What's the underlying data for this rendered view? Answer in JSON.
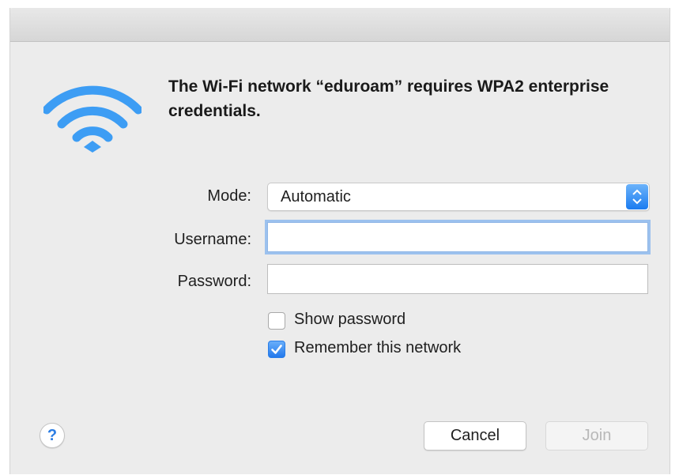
{
  "dialog": {
    "message": "The Wi-Fi network “eduroam” requires WPA2 enterprise credentials.",
    "icon": "wifi-icon"
  },
  "form": {
    "mode_label": "Mode:",
    "mode_value": "Automatic",
    "username_label": "Username:",
    "username_value": "",
    "password_label": "Password:",
    "password_value": ""
  },
  "options": {
    "show_password_label": "Show password",
    "show_password_checked": false,
    "remember_label": "Remember this network",
    "remember_checked": true
  },
  "footer": {
    "help_label": "?",
    "cancel_label": "Cancel",
    "join_label": "Join",
    "join_enabled": false
  },
  "colors": {
    "accent": "#2b7de4",
    "wifi": "#3d9df4",
    "dialog_bg": "#ececec"
  }
}
